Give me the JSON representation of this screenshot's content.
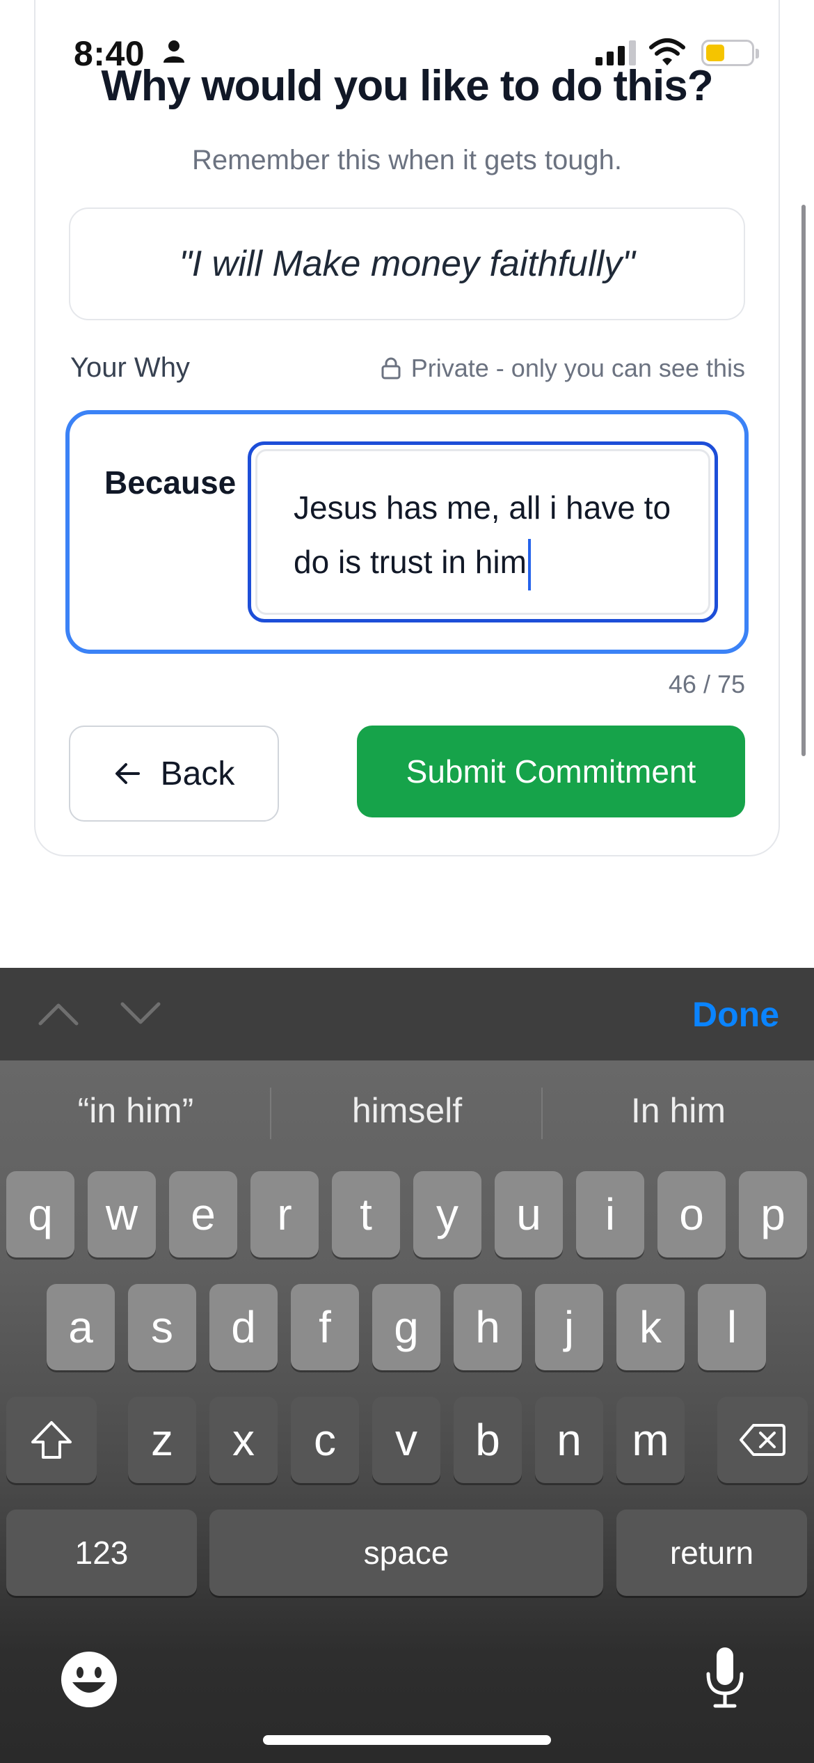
{
  "status_bar": {
    "time": "8:40"
  },
  "header": {
    "title": "Why would you like to do this?",
    "subtitle": "Remember this when it gets tough."
  },
  "commitment": {
    "quote": "\"I will Make money faithfully\""
  },
  "why_section": {
    "label": "Your Why",
    "privacy_note": "Private - only you can see this",
    "prefix": "Because",
    "input_value": "Jesus has me, all i have to do is trust in him",
    "counter": "46 / 75"
  },
  "actions": {
    "back_label": "Back",
    "submit_label": "Submit Commitment"
  },
  "keyboard": {
    "done_label": "Done",
    "suggestions": [
      "“in him”",
      "himself",
      "In him"
    ],
    "row1": [
      "q",
      "w",
      "e",
      "r",
      "t",
      "y",
      "u",
      "i",
      "o",
      "p"
    ],
    "row2": [
      "a",
      "s",
      "d",
      "f",
      "g",
      "h",
      "j",
      "k",
      "l"
    ],
    "row3": [
      "z",
      "x",
      "c",
      "v",
      "b",
      "n",
      "m"
    ],
    "numbers_label": "123",
    "space_label": "space",
    "return_label": "return"
  },
  "colors": {
    "accent_blue": "#3b82f6",
    "submit_green": "#16a34a",
    "done_blue": "#0a84ff",
    "badge_orange": "#fde7d6"
  }
}
